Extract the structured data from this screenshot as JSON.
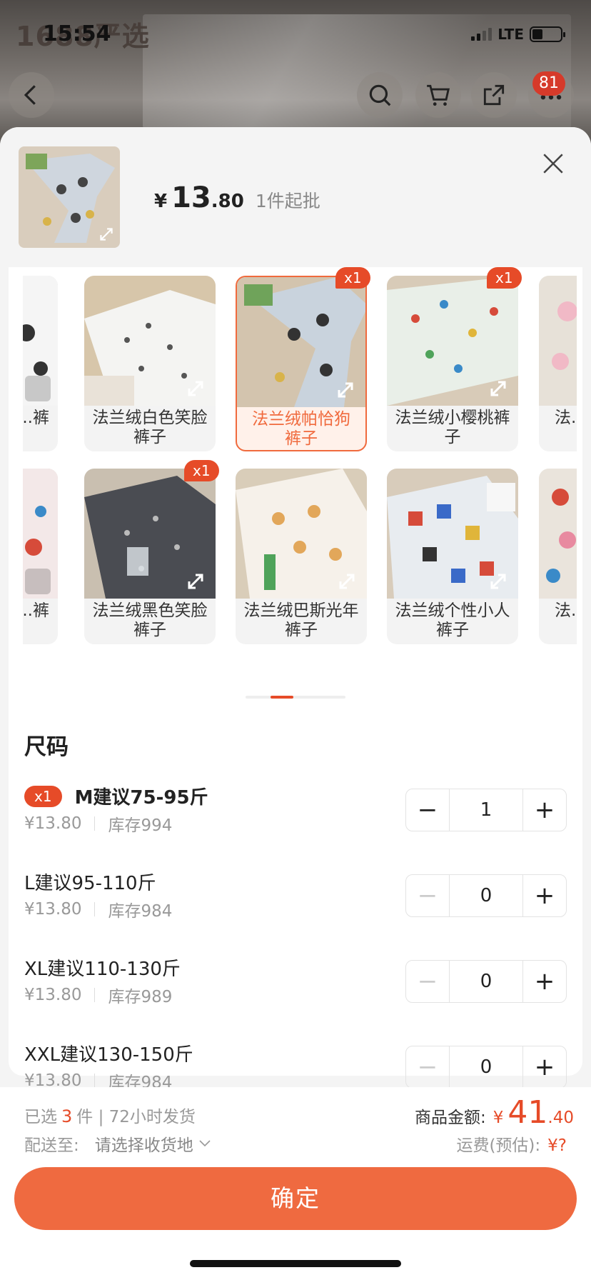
{
  "app": {
    "title_ghost": "1688严选"
  },
  "status_bar": {
    "time": "15:54",
    "network": "LTE"
  },
  "top_nav": {
    "cart_badge": "81"
  },
  "product": {
    "price_symbol": "¥",
    "price_int": "13",
    "price_dec": ".80",
    "moq": "1件起批"
  },
  "variants": [
    {
      "label": "...裤",
      "badge": ""
    },
    {
      "label": "法兰绒白色笑脸裤子",
      "badge": ""
    },
    {
      "label": "法兰绒帕恰狗裤子",
      "badge": "x1",
      "selected": true
    },
    {
      "label": "法兰绒小樱桃裤子",
      "badge": "x1"
    },
    {
      "label": "法...",
      "badge": ""
    },
    {
      "label": "...裤",
      "badge": ""
    },
    {
      "label": "法兰绒黑色笑脸裤子",
      "badge": "x1"
    },
    {
      "label": "法兰绒巴斯光年裤子",
      "badge": ""
    },
    {
      "label": "法兰绒个性小人裤子",
      "badge": ""
    },
    {
      "label": "法...",
      "badge": ""
    }
  ],
  "sizes_title": "尺码",
  "sizes": [
    {
      "name": "M建议75-95斤",
      "badge": "x1",
      "price": "¥13.80",
      "stock": "库存994",
      "qty": "1"
    },
    {
      "name": "L建议95-110斤",
      "badge": "",
      "price": "¥13.80",
      "stock": "库存984",
      "qty": "0"
    },
    {
      "name": "XL建议110-130斤",
      "badge": "",
      "price": "¥13.80",
      "stock": "库存989",
      "qty": "0"
    },
    {
      "name": "XXL建议130-150斤",
      "badge": "",
      "price": "¥13.80",
      "stock": "库存984",
      "qty": "0"
    }
  ],
  "footer": {
    "selected_prefix": "已选",
    "selected_count": "3",
    "selected_suffix": "件 | 72小时发货",
    "ship_label": "配送至:",
    "ship_value": "请选择收货地",
    "amount_label": "商品金额:",
    "amount_symbol": "¥",
    "amount_int": "41",
    "amount_dec": ".40",
    "freight_label": "运费(预估):",
    "freight_value": "¥?",
    "confirm_label": "确定"
  },
  "colors": {
    "accent": "#ef6a40",
    "badge": "#e64b28"
  }
}
